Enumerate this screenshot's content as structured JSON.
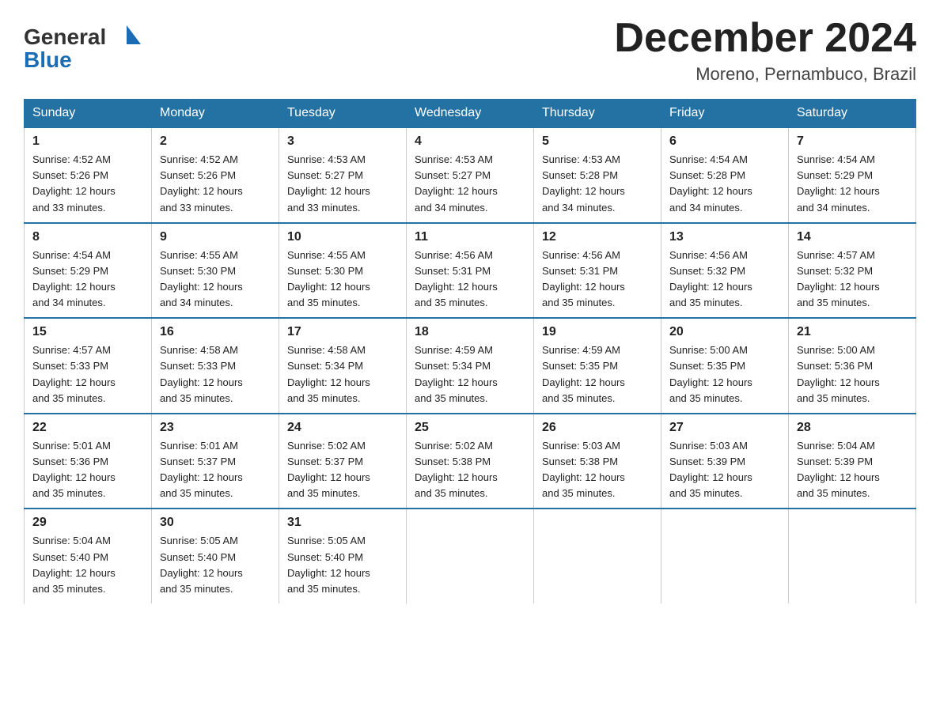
{
  "header": {
    "logo": {
      "general": "General",
      "blue": "Blue",
      "triangle": "▶"
    },
    "title": "December 2024",
    "location": "Moreno, Pernambuco, Brazil"
  },
  "days_of_week": [
    "Sunday",
    "Monday",
    "Tuesday",
    "Wednesday",
    "Thursday",
    "Friday",
    "Saturday"
  ],
  "weeks": [
    [
      {
        "day": "1",
        "sunrise": "4:52 AM",
        "sunset": "5:26 PM",
        "daylight": "12 hours and 33 minutes."
      },
      {
        "day": "2",
        "sunrise": "4:52 AM",
        "sunset": "5:26 PM",
        "daylight": "12 hours and 33 minutes."
      },
      {
        "day": "3",
        "sunrise": "4:53 AM",
        "sunset": "5:27 PM",
        "daylight": "12 hours and 33 minutes."
      },
      {
        "day": "4",
        "sunrise": "4:53 AM",
        "sunset": "5:27 PM",
        "daylight": "12 hours and 34 minutes."
      },
      {
        "day": "5",
        "sunrise": "4:53 AM",
        "sunset": "5:28 PM",
        "daylight": "12 hours and 34 minutes."
      },
      {
        "day": "6",
        "sunrise": "4:54 AM",
        "sunset": "5:28 PM",
        "daylight": "12 hours and 34 minutes."
      },
      {
        "day": "7",
        "sunrise": "4:54 AM",
        "sunset": "5:29 PM",
        "daylight": "12 hours and 34 minutes."
      }
    ],
    [
      {
        "day": "8",
        "sunrise": "4:54 AM",
        "sunset": "5:29 PM",
        "daylight": "12 hours and 34 minutes."
      },
      {
        "day": "9",
        "sunrise": "4:55 AM",
        "sunset": "5:30 PM",
        "daylight": "12 hours and 34 minutes."
      },
      {
        "day": "10",
        "sunrise": "4:55 AM",
        "sunset": "5:30 PM",
        "daylight": "12 hours and 35 minutes."
      },
      {
        "day": "11",
        "sunrise": "4:56 AM",
        "sunset": "5:31 PM",
        "daylight": "12 hours and 35 minutes."
      },
      {
        "day": "12",
        "sunrise": "4:56 AM",
        "sunset": "5:31 PM",
        "daylight": "12 hours and 35 minutes."
      },
      {
        "day": "13",
        "sunrise": "4:56 AM",
        "sunset": "5:32 PM",
        "daylight": "12 hours and 35 minutes."
      },
      {
        "day": "14",
        "sunrise": "4:57 AM",
        "sunset": "5:32 PM",
        "daylight": "12 hours and 35 minutes."
      }
    ],
    [
      {
        "day": "15",
        "sunrise": "4:57 AM",
        "sunset": "5:33 PM",
        "daylight": "12 hours and 35 minutes."
      },
      {
        "day": "16",
        "sunrise": "4:58 AM",
        "sunset": "5:33 PM",
        "daylight": "12 hours and 35 minutes."
      },
      {
        "day": "17",
        "sunrise": "4:58 AM",
        "sunset": "5:34 PM",
        "daylight": "12 hours and 35 minutes."
      },
      {
        "day": "18",
        "sunrise": "4:59 AM",
        "sunset": "5:34 PM",
        "daylight": "12 hours and 35 minutes."
      },
      {
        "day": "19",
        "sunrise": "4:59 AM",
        "sunset": "5:35 PM",
        "daylight": "12 hours and 35 minutes."
      },
      {
        "day": "20",
        "sunrise": "5:00 AM",
        "sunset": "5:35 PM",
        "daylight": "12 hours and 35 minutes."
      },
      {
        "day": "21",
        "sunrise": "5:00 AM",
        "sunset": "5:36 PM",
        "daylight": "12 hours and 35 minutes."
      }
    ],
    [
      {
        "day": "22",
        "sunrise": "5:01 AM",
        "sunset": "5:36 PM",
        "daylight": "12 hours and 35 minutes."
      },
      {
        "day": "23",
        "sunrise": "5:01 AM",
        "sunset": "5:37 PM",
        "daylight": "12 hours and 35 minutes."
      },
      {
        "day": "24",
        "sunrise": "5:02 AM",
        "sunset": "5:37 PM",
        "daylight": "12 hours and 35 minutes."
      },
      {
        "day": "25",
        "sunrise": "5:02 AM",
        "sunset": "5:38 PM",
        "daylight": "12 hours and 35 minutes."
      },
      {
        "day": "26",
        "sunrise": "5:03 AM",
        "sunset": "5:38 PM",
        "daylight": "12 hours and 35 minutes."
      },
      {
        "day": "27",
        "sunrise": "5:03 AM",
        "sunset": "5:39 PM",
        "daylight": "12 hours and 35 minutes."
      },
      {
        "day": "28",
        "sunrise": "5:04 AM",
        "sunset": "5:39 PM",
        "daylight": "12 hours and 35 minutes."
      }
    ],
    [
      {
        "day": "29",
        "sunrise": "5:04 AM",
        "sunset": "5:40 PM",
        "daylight": "12 hours and 35 minutes."
      },
      {
        "day": "30",
        "sunrise": "5:05 AM",
        "sunset": "5:40 PM",
        "daylight": "12 hours and 35 minutes."
      },
      {
        "day": "31",
        "sunrise": "5:05 AM",
        "sunset": "5:40 PM",
        "daylight": "12 hours and 35 minutes."
      },
      null,
      null,
      null,
      null
    ]
  ],
  "labels": {
    "sunrise": "Sunrise:",
    "sunset": "Sunset:",
    "daylight": "Daylight:"
  }
}
